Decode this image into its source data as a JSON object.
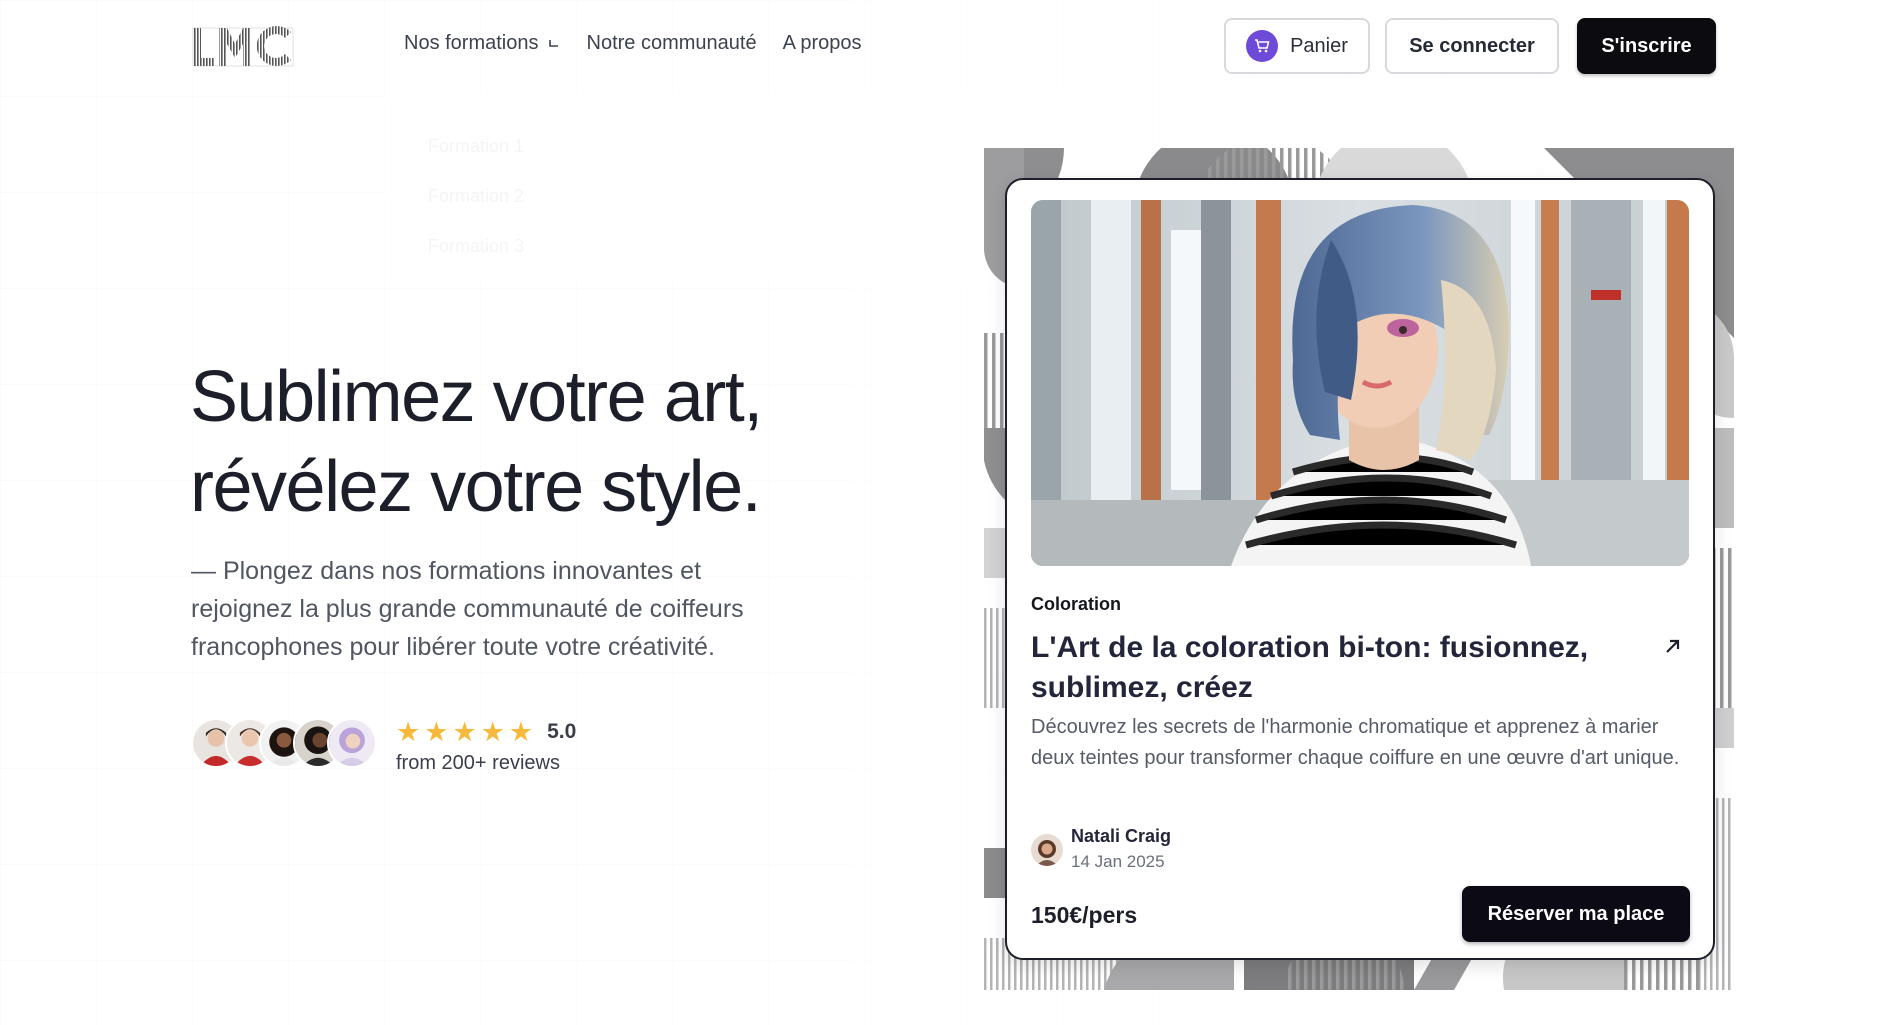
{
  "header": {
    "logo_text": "LMC",
    "nav": [
      {
        "label": "Nos formations",
        "has_dropdown": true
      },
      {
        "label": "Notre communauté",
        "has_dropdown": false
      },
      {
        "label": "A propos",
        "has_dropdown": false
      }
    ],
    "dropdown_items": [
      "Formation 1",
      "Formation 2",
      "Formation 3"
    ],
    "cart_label": "Panier",
    "login_label": "Se connecter",
    "signup_label": "S'inscrire"
  },
  "hero": {
    "title_line1": "Sublimez votre art,",
    "title_line2": "révélez votre style.",
    "subtitle": "— Plongez dans nos formations innovantes et rejoignez la plus grande communauté de coiffeurs francophones pour libérer toute votre créativité.",
    "rating": "5.0",
    "stars": 5,
    "review_count": "from 200+ reviews"
  },
  "card": {
    "category": "Coloration",
    "title": "L'Art de la coloration bi-ton: fusionnez, sublimez, créez",
    "description": "Découvrez les secrets de l'harmonie chromatique et apprenez à marier deux teintes pour transformer chaque coiffure en une œuvre d'art unique.",
    "author_name": "Natali Craig",
    "date": "14 Jan 2025",
    "price": "150€/pers",
    "cta_label": "Réserver ma place"
  },
  "colors": {
    "accent_purple": "#6e4ad9",
    "button_dark": "#0b0b10",
    "star": "#f6b93b",
    "text_dark": "#1c1f2a",
    "text_muted": "#515663"
  },
  "icons": [
    "cart-icon",
    "chevron-down-icon",
    "star-icon",
    "arrow-up-right-icon"
  ]
}
